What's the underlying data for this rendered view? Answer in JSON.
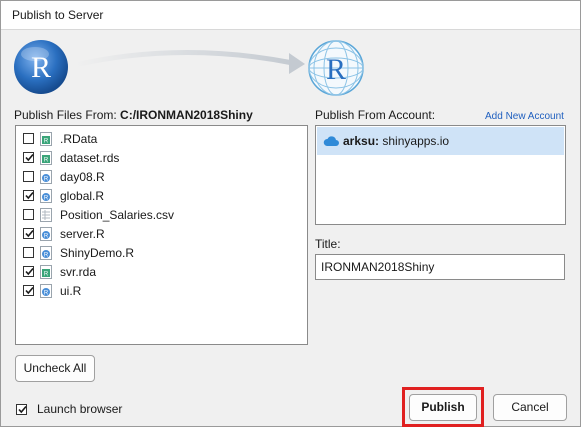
{
  "dialog": {
    "title": "Publish to Server"
  },
  "files": {
    "label_prefix": "Publish Files From:",
    "path": "C:/IRONMAN2018Shiny",
    "items": [
      {
        "name": ".RData",
        "checked": false,
        "icon": "rdata-file-icon"
      },
      {
        "name": "dataset.rds",
        "checked": true,
        "icon": "rds-file-icon"
      },
      {
        "name": "day08.R",
        "checked": false,
        "icon": "r-script-icon"
      },
      {
        "name": "global.R",
        "checked": true,
        "icon": "r-script-icon"
      },
      {
        "name": "Position_Salaries.csv",
        "checked": false,
        "icon": "csv-file-icon"
      },
      {
        "name": "server.R",
        "checked": true,
        "icon": "r-script-icon"
      },
      {
        "name": "ShinyDemo.R",
        "checked": false,
        "icon": "r-script-icon"
      },
      {
        "name": "svr.rda",
        "checked": true,
        "icon": "rda-file-icon"
      },
      {
        "name": "ui.R",
        "checked": true,
        "icon": "r-script-icon"
      }
    ]
  },
  "account": {
    "label": "Publish From Account:",
    "add_link": "Add New Account",
    "user": "arksu:",
    "server": "shinyapps.io"
  },
  "app_title": {
    "label": "Title:",
    "value": "IRONMAN2018Shiny"
  },
  "buttons": {
    "uncheck_all": "Uncheck All",
    "publish": "Publish",
    "cancel": "Cancel"
  },
  "launch_browser": {
    "label": "Launch browser",
    "checked": true
  },
  "colors": {
    "highlight": "#e02020",
    "selection": "#cfe3f7",
    "link": "#1f5fbf",
    "r_blue": "#2a6fc0"
  }
}
